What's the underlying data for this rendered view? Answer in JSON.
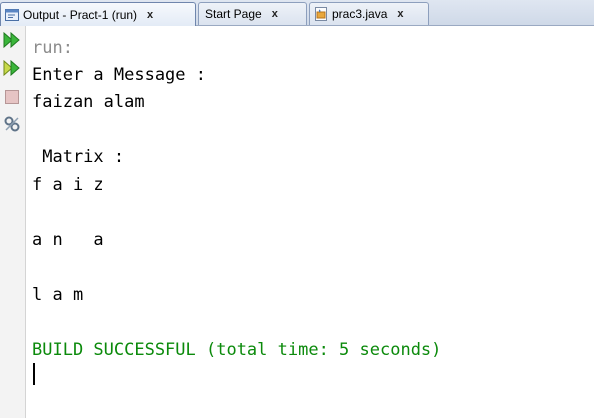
{
  "tabs": [
    {
      "label": "Output - Pract-1 (run)",
      "icon": "output-window-icon",
      "close": "x",
      "active": true
    },
    {
      "label": "Start Page",
      "icon": "",
      "close": "x",
      "active": false
    },
    {
      "label": "prac3.java",
      "icon": "java-file-icon",
      "close": "x",
      "active": false
    }
  ],
  "toolbar": {
    "buttons": [
      {
        "icon": "rerun-icon",
        "color": "#2e9a2e"
      },
      {
        "icon": "rerun-with-options-icon",
        "color": "#2e9a2e"
      },
      {
        "icon": "stop-icon",
        "color": "#c9a3a3"
      },
      {
        "icon": "settings-icon",
        "color": "#6d7f93"
      }
    ]
  },
  "output": {
    "lines": [
      {
        "text": "run:",
        "style": "gray"
      },
      {
        "text": "Enter a Message :",
        "style": "normal"
      },
      {
        "text": "faizan alam",
        "style": "normal"
      },
      {
        "text": "",
        "style": "normal"
      },
      {
        "text": " Matrix :",
        "style": "normal"
      },
      {
        "text": "f a i z",
        "style": "normal"
      },
      {
        "text": "",
        "style": "normal"
      },
      {
        "text": "a n   a",
        "style": "normal"
      },
      {
        "text": "",
        "style": "normal"
      },
      {
        "text": "l a m",
        "style": "normal"
      },
      {
        "text": "",
        "style": "normal"
      },
      {
        "text": "BUILD SUCCESSFUL (total time: 5 seconds)",
        "style": "green"
      }
    ]
  },
  "colors": {
    "build_success": "#0b8a0b",
    "run_label": "#8c8c8c"
  }
}
